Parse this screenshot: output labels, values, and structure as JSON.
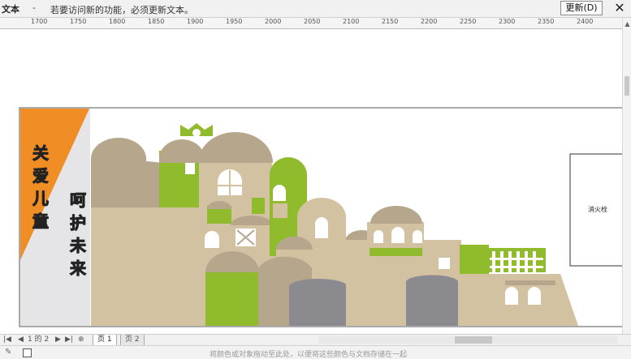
{
  "notice": {
    "label": "文本",
    "separator": "-",
    "message": "若要访问新的功能，必须更新文本。",
    "update_button": "更新(D)",
    "close_glyph": "✕"
  },
  "ruler": {
    "ticks": [
      "1700",
      "1750",
      "1800",
      "1850",
      "1900",
      "1950",
      "2000",
      "2050",
      "2100",
      "2150",
      "2200",
      "2250",
      "2300",
      "2350",
      "2400"
    ]
  },
  "design": {
    "side_text_1": "关爱儿童",
    "side_text_2": "呵护未来",
    "box_label": "消火栓",
    "colors": {
      "orange": "#f08d25",
      "beige": "#d3c2a1",
      "dark_beige": "#b6a68b",
      "green": "#8fbb2c",
      "gray": "#8b8b8f",
      "white": "#ffffff",
      "left_gray": "#e5e5e7"
    }
  },
  "pages": {
    "page_info": "1 的 2",
    "tabs": [
      "页 1",
      "页 2"
    ]
  },
  "status": {
    "hint": "将颜色或对象拖动至此处，以便将这些颜色与文档存储在一起"
  }
}
